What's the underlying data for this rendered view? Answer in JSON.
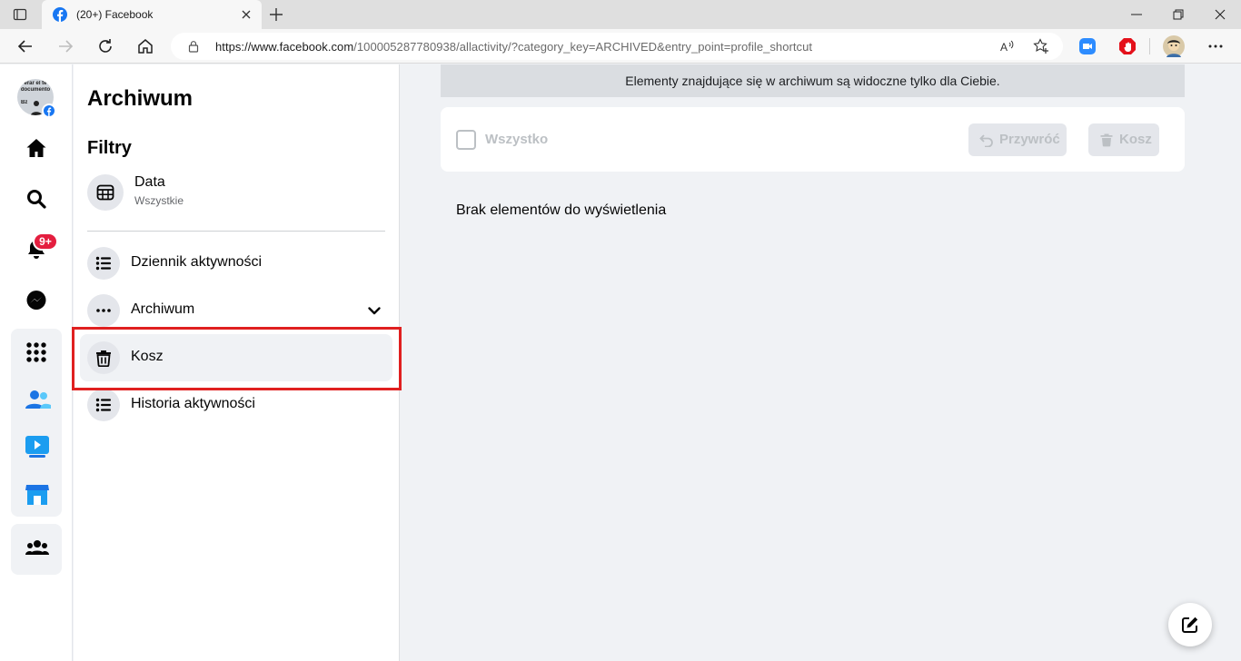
{
  "browser": {
    "tab_title": "(20+) Facebook",
    "url_host": "https://www.facebook.com",
    "url_path": "/100005287780938/allactivity/?category_key=ARCHIVED&entry_point=profile_shortcut"
  },
  "rail": {
    "avatar_lines": [
      "erar el te",
      "documento",
      "",
      "Bz"
    ],
    "notifications_badge": "9+",
    "icons": [
      "home-icon",
      "search-icon",
      "bell-icon",
      "messenger-icon",
      "menu-grid-icon",
      "friends-icon",
      "watch-icon",
      "marketplace-icon",
      "groups-icon"
    ]
  },
  "panel": {
    "title": "Archiwum",
    "filters_heading": "Filtry",
    "date_filter": {
      "label": "Data",
      "value": "Wszystkie"
    },
    "nav": [
      {
        "label": "Dziennik aktywności"
      },
      {
        "label": "Archiwum"
      },
      {
        "label": "Kosz"
      },
      {
        "label": "Historia aktywności"
      }
    ]
  },
  "main": {
    "info": "Elementy znajdujące się w archiwum są widoczne tylko dla Ciebie.",
    "select_all": "Wszystko",
    "restore_button": "Przywróć",
    "trash_button": "Kosz",
    "empty_message": "Brak elementów do wyświetlenia"
  },
  "colors": {
    "accent": "#1877f2",
    "highlight_box": "#e02020",
    "badge": "#e41e3f"
  }
}
